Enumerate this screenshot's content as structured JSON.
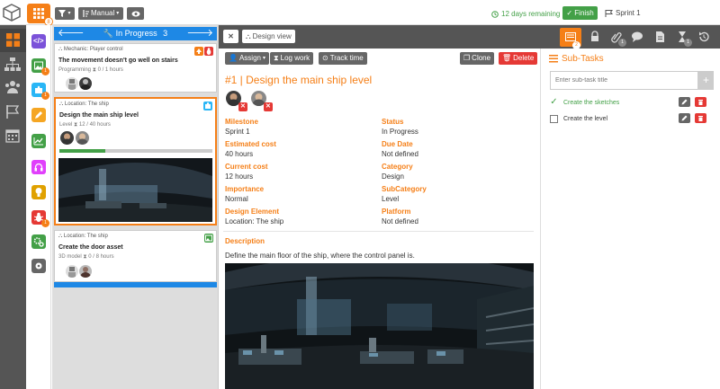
{
  "topbar": {
    "filter_label": "",
    "manual_label": "Manual",
    "remaining_text": "12 days remaining",
    "finish_label": "Finish",
    "sprint_label": "Sprint 1",
    "app_badge": "8"
  },
  "leftnav": {
    "items": [
      "grid-icon",
      "hierarchy-icon",
      "team-icon",
      "flag-icon",
      "calendar-icon"
    ]
  },
  "categories": [
    {
      "icon": "code-icon",
      "color": "#7b52d9",
      "badge": ""
    },
    {
      "icon": "image-icon",
      "color": "#43a047",
      "badge": "1"
    },
    {
      "icon": "puzzle-icon",
      "color": "#29b6f6",
      "badge": "1"
    },
    {
      "icon": "pencil-icon",
      "color": "#f5a623",
      "badge": ""
    },
    {
      "icon": "chart-icon",
      "color": "#43a047",
      "badge": ""
    },
    {
      "icon": "headphones-icon",
      "color": "#e040fb",
      "badge": ""
    },
    {
      "icon": "bulb-icon",
      "color": "#e0a100",
      "badge": ""
    },
    {
      "icon": "bug-icon",
      "color": "#e53935",
      "badge": "1"
    },
    {
      "icon": "gears-icon",
      "color": "#43a047",
      "badge": ""
    },
    {
      "icon": "box-icon",
      "color": "#666666",
      "badge": ""
    }
  ],
  "list": {
    "header_label": "In Progress",
    "header_count": "3",
    "cards": [
      {
        "meta": "Mechanic: Player control",
        "title": "The movement doesn't go well on stairs",
        "sub": "Programming",
        "hours": "0 / 1 hours"
      },
      {
        "meta": "Location: The ship",
        "title": "Design the main ship level",
        "sub": "Level",
        "hours": "12 / 40 hours",
        "progress": 0.3
      },
      {
        "meta": "Location: The ship",
        "title": "Create the door asset",
        "sub": "3D model",
        "hours": "0 / 8 hours"
      }
    ]
  },
  "detail": {
    "close_label": "",
    "design_view_label": "Design view",
    "assign_label": "Assign",
    "log_work_label": "Log work",
    "track_time_label": "Track time",
    "clone_label": "Clone",
    "delete_label": "Delete",
    "title": "#1 | Design the main ship level",
    "fields": {
      "milestone_label": "Milestone",
      "milestone": "Sprint 1",
      "status_label": "Status",
      "status": "In Progress",
      "estimated_label": "Estimated cost",
      "estimated": "40 hours",
      "due_label": "Due Date",
      "due": "Not defined",
      "current_label": "Current cost",
      "current": "12 hours",
      "category_label": "Category",
      "category": "Design",
      "importance_label": "Importance",
      "importance": "Normal",
      "subcategory_label": "SubCategory",
      "subcategory": "Level",
      "element_label": "Design Element",
      "element": "Location: The ship",
      "platform_label": "Platform",
      "platform": "Not defined"
    },
    "description_label": "Description",
    "description": "Define the main floor of the ship, where the control panel is."
  },
  "rightbar": {
    "icons": [
      {
        "name": "subtasks-icon",
        "badge": "2"
      },
      {
        "name": "lock-icon",
        "badge": ""
      },
      {
        "name": "attachment-icon",
        "badge": "1"
      },
      {
        "name": "comment-icon",
        "badge": ""
      },
      {
        "name": "document-icon",
        "badge": ""
      },
      {
        "name": "hourglass-icon",
        "badge": "1"
      },
      {
        "name": "history-icon",
        "badge": ""
      }
    ]
  },
  "subtasks": {
    "header": "Sub-Tasks",
    "input_placeholder": "Enter sub-task title",
    "items": [
      {
        "label": "Create the sketches",
        "done": true
      },
      {
        "label": "Create the level",
        "done": false
      }
    ]
  },
  "colors": {
    "accent": "#f57f17",
    "primary": "#1e88e5",
    "success": "#43a047",
    "danger": "#e53935",
    "dark": "#555555"
  }
}
